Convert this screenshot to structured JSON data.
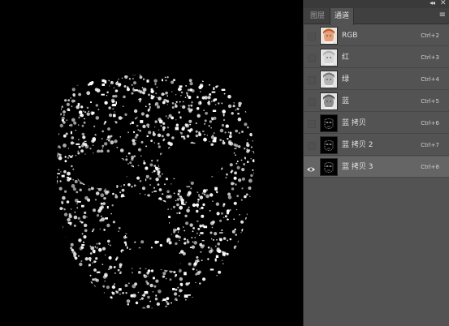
{
  "panel": {
    "tabs": [
      {
        "label": "图层",
        "active": false
      },
      {
        "label": "通道",
        "active": true
      }
    ],
    "icons": {
      "collapse": "collapse-icon",
      "close": "close-icon",
      "menu": "panel-menu-icon"
    }
  },
  "channels": [
    {
      "name": "RGB",
      "shortcut": "Ctrl+2",
      "visible": false,
      "selected": false,
      "thumb": "color-face"
    },
    {
      "name": "红",
      "shortcut": "Ctrl+3",
      "visible": false,
      "selected": false,
      "thumb": "gray-light"
    },
    {
      "name": "绿",
      "shortcut": "Ctrl+4",
      "visible": false,
      "selected": false,
      "thumb": "gray-mid"
    },
    {
      "name": "蓝",
      "shortcut": "Ctrl+5",
      "visible": false,
      "selected": false,
      "thumb": "gray-dark"
    },
    {
      "name": "蓝 拷贝",
      "shortcut": "Ctrl+6",
      "visible": false,
      "selected": false,
      "thumb": "mask"
    },
    {
      "name": "蓝 拷贝 2",
      "shortcut": "Ctrl+7",
      "visible": false,
      "selected": false,
      "thumb": "mask"
    },
    {
      "name": "蓝 拷贝 3",
      "shortcut": "Ctrl+8",
      "visible": true,
      "selected": true,
      "thumb": "mask"
    }
  ],
  "colors": {
    "panel_bg": "#535353",
    "selected_row": "#656565",
    "canvas_bg": "#000000"
  }
}
